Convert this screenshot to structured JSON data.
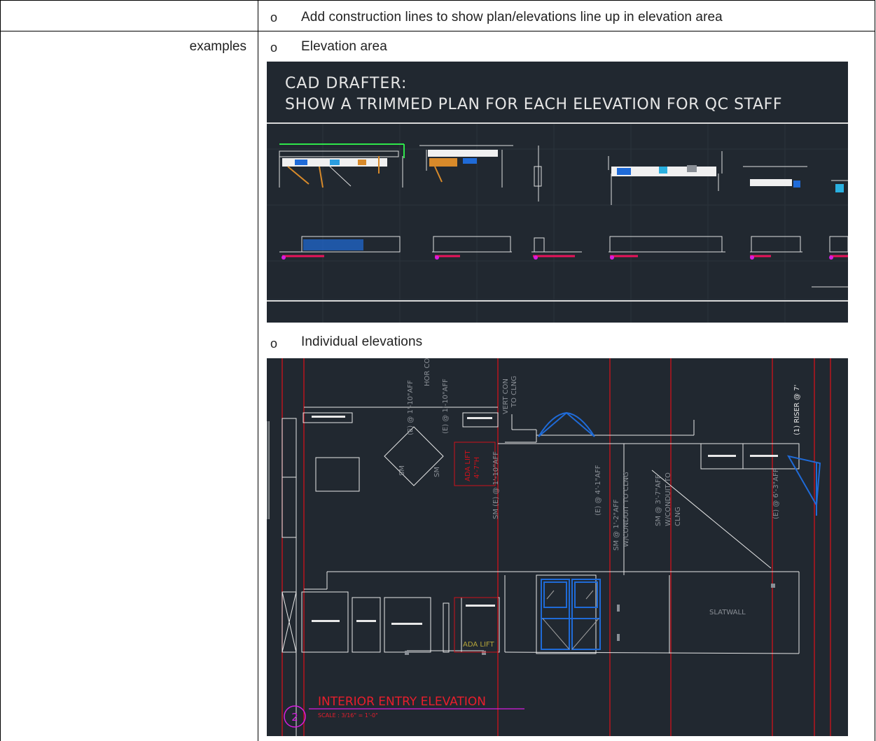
{
  "rows": [
    {
      "label": "",
      "bullet": "o",
      "text": "Add construction lines to show plan/elevations line up in elevation area"
    },
    {
      "label": "examples",
      "items": [
        {
          "bullet": "o",
          "text": "Elevation area"
        },
        {
          "bullet": "o",
          "text": "Individual elevations"
        }
      ]
    }
  ],
  "elevation_area_image": {
    "title_line1": "CAD DRAFTER:",
    "title_line2": "SHOW A TRIMMED PLAN FOR EACH ELEVATION FOR QC STAFF"
  },
  "individual_elevation_image": {
    "title": "INTERIOR ENTRY ELEVATION",
    "scale": "SCALE : 3/16\" = 1'-0\"",
    "callout_number": "2",
    "tags": {
      "ada_lift_upper": "ADA LIFT",
      "ada_lift_height": "4'-7\"H",
      "ada_lift_lower": "ADA LIFT",
      "slatwall": "SLATWALL",
      "riser": "(1) RISER @ 7'",
      "hor_con": "HOR\nCON",
      "vert_con": "VERT CON",
      "to_clng": "TO CLNG",
      "sm_e_1": "SM",
      "sm_e_2": "(E) @ 1'-10\"AFF",
      "sm_e_3": "SM",
      "sm_e_4": "(E) @ 1'-10\"AFF",
      "sm_e_5": "SM (E) @ 1'-10\"AFF",
      "e_4_1": "(E) @ 4'-1\"AFF",
      "sm_1_2": "SM @ 1'-2\"AFF",
      "wconduit_1": "W/CONDUIT TO CLNG",
      "sm_3_7": "SM @ 3'-7\"AFF",
      "wconduit_2": "W/CONDUIT TO",
      "clng": "CLNG",
      "e_6_3": "(E) @ 6'-3\"AFF"
    }
  },
  "colors": {
    "cad_background": "#212830",
    "cad_red": "#d0121b",
    "cad_magenta": "#d81ce0",
    "cad_blue": "#1f6bd8",
    "cad_white": "#e8e8e8",
    "cad_gray": "#8a8f96"
  }
}
